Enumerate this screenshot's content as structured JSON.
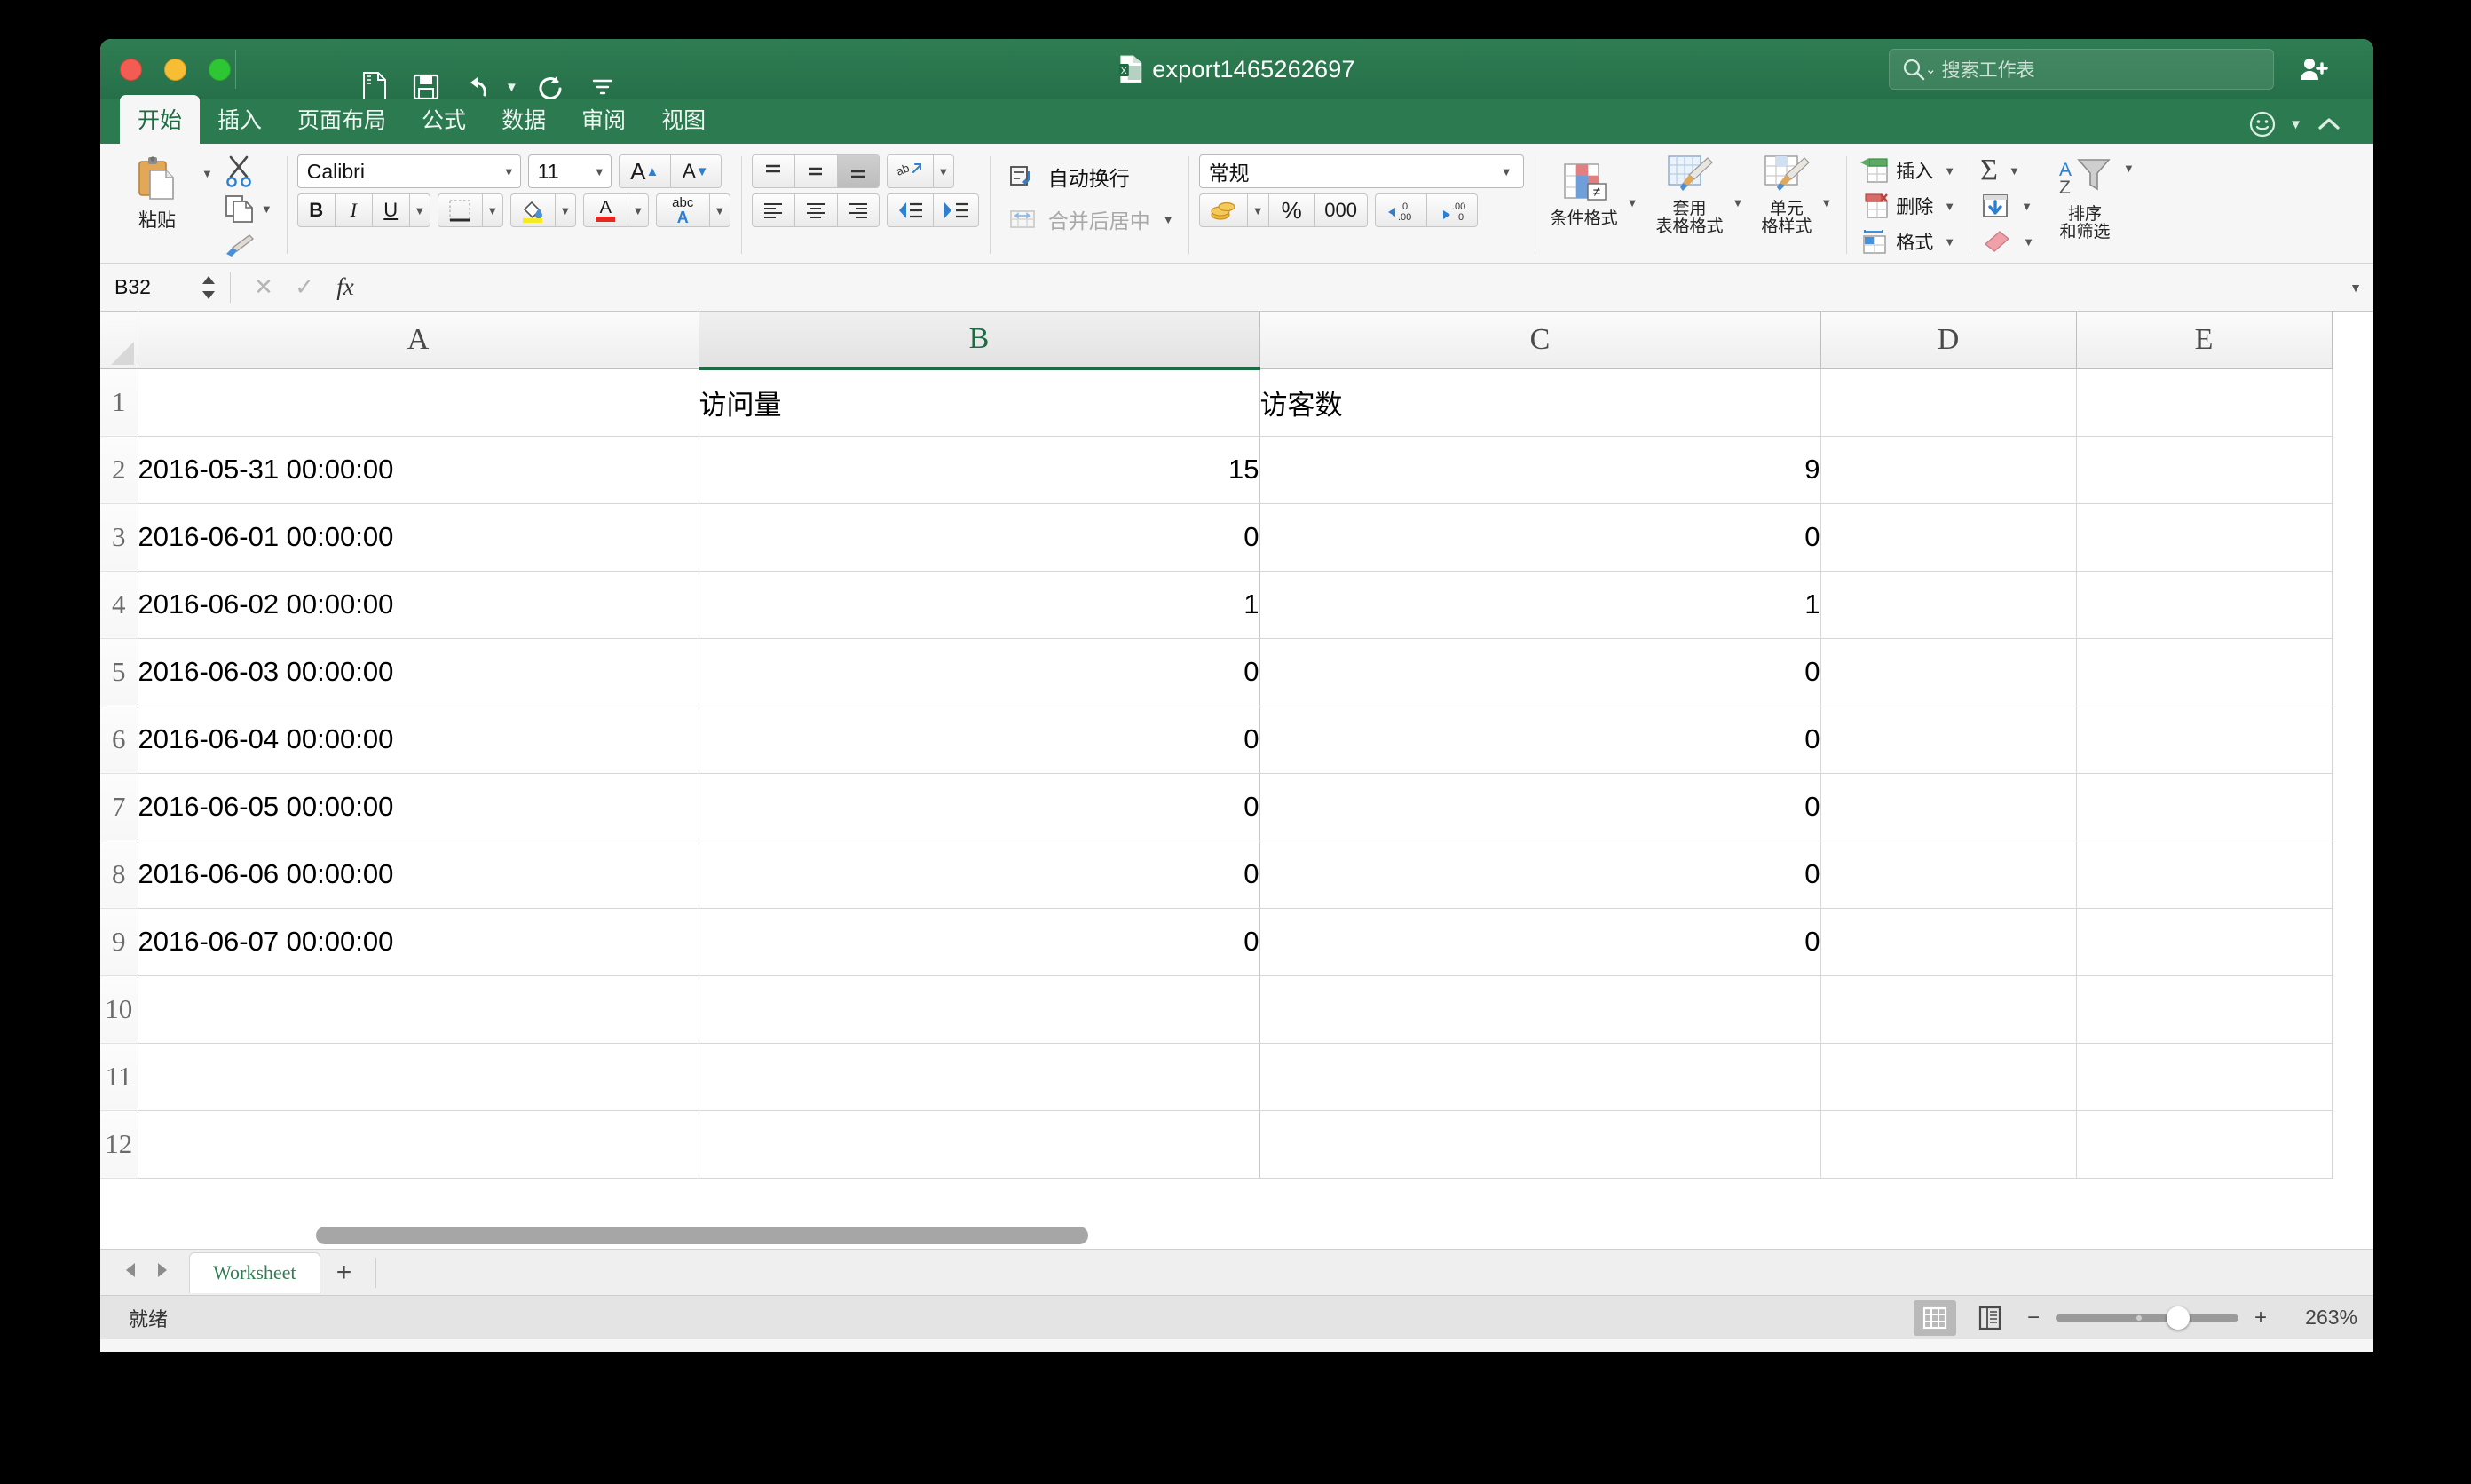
{
  "window": {
    "title": "export1465262697",
    "titlebar_color": "#2c7a50"
  },
  "quick_access": [
    {
      "name": "new-document-icon",
      "label": "新建"
    },
    {
      "name": "save-icon",
      "label": "保存"
    },
    {
      "name": "undo-icon",
      "label": "撤消"
    },
    {
      "name": "redo-icon",
      "label": "恢复"
    },
    {
      "name": "customize-qat-icon",
      "label": "自定义快速访问工具栏"
    }
  ],
  "search": {
    "placeholder": "搜索工作表",
    "icon": "search-icon"
  },
  "share": {
    "icon": "add-user-icon"
  },
  "tabs": [
    {
      "label": "开始",
      "active": true
    },
    {
      "label": "插入",
      "active": false
    },
    {
      "label": "页面布局",
      "active": false
    },
    {
      "label": "公式",
      "active": false
    },
    {
      "label": "数据",
      "active": false
    },
    {
      "label": "审阅",
      "active": false
    },
    {
      "label": "视图",
      "active": false
    }
  ],
  "ribbon": {
    "clipboard": {
      "paste_label": "粘贴",
      "cut_label": "剪切",
      "copy_label": "复制",
      "format_painter_label": "格式刷"
    },
    "font": {
      "family_value": "Calibri",
      "size_value": "11",
      "grow_label": "A",
      "shrink_label": "A",
      "bold_label": "B",
      "italic_label": "I",
      "underline_label": "U",
      "borders_label": "边框",
      "fill_label": "填充颜色",
      "color_label": "A",
      "phonetic_label": "abc"
    },
    "alignment": {
      "align_top": "顶端对齐",
      "align_middle": "垂直居中",
      "align_bottom": "底端对齐",
      "orientation": "ab",
      "align_left": "左对齐",
      "align_center": "居中",
      "align_right": "右对齐",
      "decrease_indent": "减少缩进量",
      "increase_indent": "增加缩进量",
      "wrap_text_label": "自动换行",
      "merge_center_label": "合并后居中"
    },
    "number": {
      "format_value": "常规",
      "accounting_label": "会计数字格式",
      "percent_label": "%",
      "comma_label": "000",
      "increase_decimal_label": ".00",
      "decrease_decimal_label": ".00"
    },
    "styles": {
      "conditional_label": "条件格式",
      "table_label": "套用\n表格格式",
      "table_label_line1": "套用",
      "table_label_line2": "表格格式",
      "cellstyle_label_line1": "单元",
      "cellstyle_label_line2": "格样式"
    },
    "cells": {
      "insert_label": "插入",
      "delete_label": "删除",
      "format_label": "格式"
    },
    "editing": {
      "autosum_label": "Σ",
      "fill_label": "填充",
      "clear_label": "清除",
      "sort_filter_line1": "排序",
      "sort_filter_line2": "和筛选"
    }
  },
  "formula_bar": {
    "name_box_value": "B32",
    "cancel_icon": "close-icon",
    "confirm_icon": "check-icon",
    "function_icon": "fx",
    "formula_value": ""
  },
  "grid": {
    "column_headers": [
      "A",
      "B",
      "C",
      "D",
      "E"
    ],
    "selected_column": "B",
    "row_headers": [
      "1",
      "2",
      "3",
      "4",
      "5",
      "6",
      "7",
      "8",
      "9",
      "10",
      "11",
      "12"
    ],
    "rows": [
      {
        "r": "1",
        "A": "",
        "B": "访问量",
        "C": "访客数",
        "D": "",
        "E": "",
        "text": true
      },
      {
        "r": "2",
        "A": "2016-05-31 00:00:00",
        "B": "15",
        "C": "9",
        "D": "",
        "E": ""
      },
      {
        "r": "3",
        "A": "2016-06-01 00:00:00",
        "B": "0",
        "C": "0",
        "D": "",
        "E": ""
      },
      {
        "r": "4",
        "A": "2016-06-02 00:00:00",
        "B": "1",
        "C": "1",
        "D": "",
        "E": ""
      },
      {
        "r": "5",
        "A": "2016-06-03 00:00:00",
        "B": "0",
        "C": "0",
        "D": "",
        "E": ""
      },
      {
        "r": "6",
        "A": "2016-06-04 00:00:00",
        "B": "0",
        "C": "0",
        "D": "",
        "E": ""
      },
      {
        "r": "7",
        "A": "2016-06-05 00:00:00",
        "B": "0",
        "C": "0",
        "D": "",
        "E": ""
      },
      {
        "r": "8",
        "A": "2016-06-06 00:00:00",
        "B": "0",
        "C": "0",
        "D": "",
        "E": ""
      },
      {
        "r": "9",
        "A": "2016-06-07 00:00:00",
        "B": "0",
        "C": "0",
        "D": "",
        "E": ""
      },
      {
        "r": "10",
        "A": "",
        "B": "",
        "C": "",
        "D": "",
        "E": ""
      },
      {
        "r": "11",
        "A": "",
        "B": "",
        "C": "",
        "D": "",
        "E": ""
      },
      {
        "r": "12",
        "A": "",
        "B": "",
        "C": "",
        "D": "",
        "E": ""
      }
    ]
  },
  "sheet_tabs": {
    "prev_label": "◀",
    "next_label": "▶",
    "tabs": [
      {
        "label": "Worksheet",
        "active": true
      }
    ],
    "add_label": "+"
  },
  "status_bar": {
    "state": "就绪",
    "normal_view_label": "普通视图",
    "page_layout_label": "页面布局视图",
    "zoom_out_label": "−",
    "zoom_in_label": "+",
    "zoom_value": "263%"
  }
}
